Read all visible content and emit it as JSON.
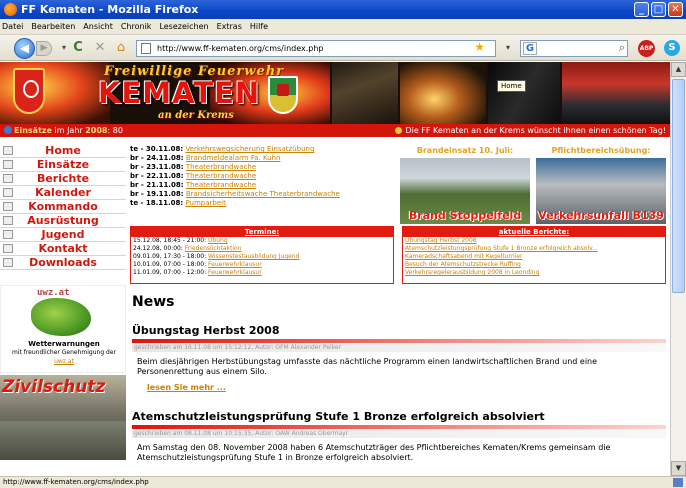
{
  "window": {
    "title": "FF Kematen - Mozilla Firefox"
  },
  "menu": [
    "Datei",
    "Bearbeiten",
    "Ansicht",
    "Chronik",
    "Lesezeichen",
    "Extras",
    "Hilfe"
  ],
  "toolbar": {
    "url": "http://www.ff-kematen.org/cms/index.php"
  },
  "statusbar": {
    "text": "http://www.ff-kematen.org/cms/index.php"
  },
  "banner": {
    "line1": "Freiwillige Feuerwehr",
    "line2": "KEMATEN",
    "line3": "an der Krems",
    "tooltip": "Home"
  },
  "ticker": {
    "left_prefix": "Einsätze",
    "left_middle": " im Jahr ",
    "year": "2008",
    "count": ": 80",
    "right": "Die FF Kematen an der Krems wünscht Ihnen einen schönen Tag!"
  },
  "nav": [
    {
      "label": "Home",
      "icon": "house-icon"
    },
    {
      "label": "Einsätze",
      "icon": "star-icon"
    },
    {
      "label": "Berichte",
      "icon": "document-icon"
    },
    {
      "label": "Kalender",
      "icon": "calendar-icon"
    },
    {
      "label": "Kommando",
      "icon": "people-icon"
    },
    {
      "label": "Ausrüstung",
      "icon": "gear-icon"
    },
    {
      "label": "Jugend",
      "icon": "person-icon"
    },
    {
      "label": "Kontakt",
      "icon": "mail-icon"
    },
    {
      "label": "Downloads",
      "icon": "download-icon"
    }
  ],
  "uwz": {
    "logo": "uwz.at",
    "title": "Wetterwarnungen",
    "approval": "mit freundlicher Genehmigung der",
    "link": "uwz.at"
  },
  "zivilschutz": {
    "title": "Zivilschutz"
  },
  "events": [
    {
      "prefix": "te - 30.11.08:",
      "link": "Verkehrswegsicherung Einsatzübung"
    },
    {
      "prefix": "br - 24.11.08:",
      "link": "Brandmeldealarm Fa. Kuhn"
    },
    {
      "prefix": "br - 23.11.08:",
      "link": "Theaterbrandwache"
    },
    {
      "prefix": "br - 22.11.08:",
      "link": "Theaterbrandwache"
    },
    {
      "prefix": "br - 21.11.08:",
      "link": "Theaterbrandwache"
    },
    {
      "prefix": "br - 19.11.08:",
      "link": "Brandsicherheitswache Theaterbrandwache"
    },
    {
      "prefix": "te - 18.11.08:",
      "link": "Pumparbeit"
    }
  ],
  "images": [
    {
      "caption": "Brandeinsatz 10. Juli:",
      "overlay": "Brand Stoppelfeld"
    },
    {
      "caption": "Pflichtbereichsübung:",
      "overlay": "Verkehrsunfall B139"
    }
  ],
  "termine": {
    "title": "Termine:",
    "rows": [
      {
        "date": "15.12.08, 18:45 - 21:00: ",
        "link": "Übung"
      },
      {
        "date": "24.12.08, 00:00: ",
        "link": "Friedenslichtaktion"
      },
      {
        "date": "09.01.09, 17:30 - 18:00: ",
        "link": "Wissenstestausbildung Jugend"
      },
      {
        "date": "10.01.09, 07:00 - 18:00: ",
        "link": "Feuerwehrklausur"
      },
      {
        "date": "11.01.09, 07:00 - 12:00: ",
        "link": "Feuerwehrklausur"
      }
    ]
  },
  "berichte": {
    "title": "aktuelle Berichte:",
    "rows": [
      "Übungstag Herbst 2008",
      "Atemschutzleistungsprüfung Stufe 1 Bronze erfolgreich absolv...",
      "Kameradschaftsabend mit Kegelturnier",
      "Besuch der Atemschutzstrecke Ruffing",
      "Verkehrsregelerausbildung 2008 in Leonding"
    ]
  },
  "news": {
    "heading": "News",
    "articles": [
      {
        "title": "Übungstag Herbst 2008",
        "meta": "geschrieben am 16.11.08 um 15:12:12, Autor: OFM Alexander Pelker",
        "body": "Beim diesjährigen Herbstübungstag umfasste das nächtliche Programm einen landwirtschaftlichen Brand und eine Personenrettung aus einem Silo.",
        "more": "lesen Sie mehr ..."
      },
      {
        "title": "Atemschutzleistungsprüfung Stufe 1 Bronze erfolgreich absolviert",
        "meta": "geschrieben am 08.11.08 um 10:15:35, Autor: OAW Andreas Obermayr",
        "body": "Am Samstag den 08. November 2008 haben 6 Atemschutzträger des Pflichtbereiches Kematen/Krems gemeinsam die Atemschutzleistungsprüfung Stufe 1 in Bronze erfolgreich absolviert.",
        "more": ""
      }
    ]
  }
}
